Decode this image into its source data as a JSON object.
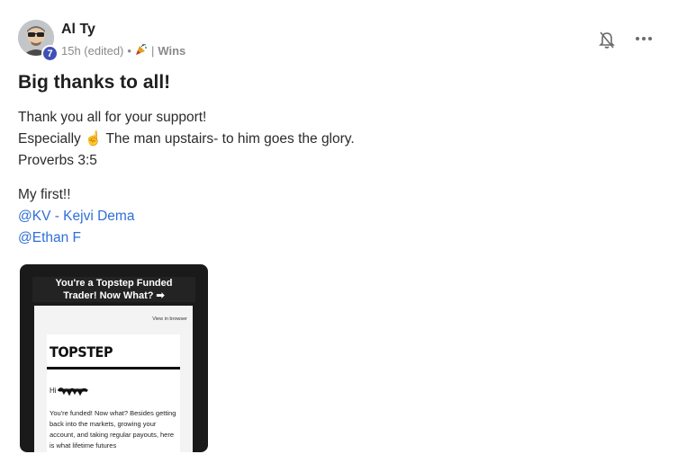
{
  "post": {
    "author": "Al Ty",
    "level": "7",
    "time": "15h (edited)",
    "separator": "•",
    "category_sep": "|",
    "category": "Wins",
    "title": "Big thanks to all!",
    "body": {
      "line1": "Thank you all for your support!",
      "line2_pre": "Especially",
      "line2_emoji": "☝",
      "line2_post": "The man upstairs- to him goes the glory.",
      "line3": "Proverbs 3:5",
      "line4": "My first!!",
      "mention1": "@KV - Kejvi Dema",
      "mention2": "@Ethan F"
    }
  },
  "attachment": {
    "headline_1": "You're a Topstep Funded",
    "headline_2": "Trader! Now What? ➡",
    "view_in_browser": "View in browser",
    "brand": "TOPSTEP",
    "greeting": "Hi",
    "text": "You're funded! Now what? Besides getting back into the markets, growing your account, and taking regular payouts, here is what lifetime futures"
  },
  "icons": {
    "bell": "bell-off-icon",
    "more": "more-horizontal-icon",
    "emoji_category": "party-popper-icon"
  },
  "colors": {
    "mention": "#2f6fd6",
    "badge": "#3f51b5"
  }
}
